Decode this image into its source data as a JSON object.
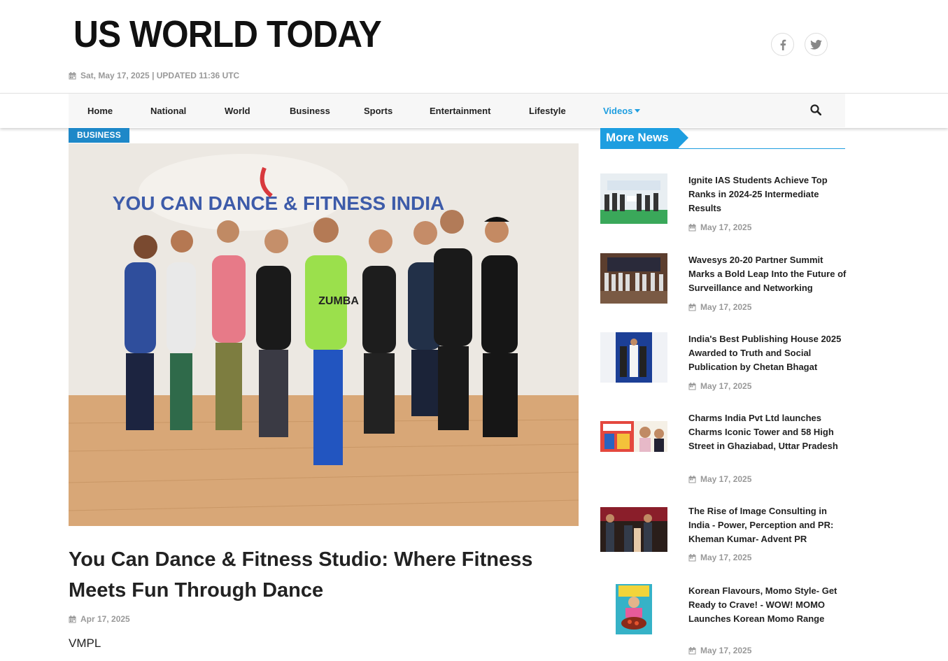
{
  "site": {
    "logo": "US WORLD TODAY",
    "date_line": "Sat, May 17, 2025 | UPDATED 11:36 UTC"
  },
  "social": [
    {
      "name": "facebook-icon"
    },
    {
      "name": "twitter-icon"
    }
  ],
  "nav": {
    "items": [
      "Home",
      "National",
      "World",
      "Business",
      "Sports",
      "Entertainment",
      "Lifestyle",
      "Videos"
    ],
    "active": "Videos"
  },
  "article": {
    "category": "BUSINESS",
    "title": "You Can Dance & Fitness Studio: Where Fitness Meets Fun Through Dance",
    "date": "Apr 17, 2025",
    "byline": "VMPL",
    "image_sign_text": "YOU CAN DANCE & FITNESS INDIA",
    "image_shirt_text": "ZUMBA"
  },
  "sidebar": {
    "heading": "More News",
    "items": [
      {
        "title": "Ignite IAS Students Achieve Top Ranks in 2024-25 Intermediate Results",
        "date": "May 17, 2025"
      },
      {
        "title": "Wavesys 20-20 Partner Summit Marks a Bold Leap Into the Future of Surveillance and Networking",
        "date": "May 17, 2025"
      },
      {
        "title": "India's Best Publishing House 2025 Awarded to Truth and Social Publication by Chetan Bhagat",
        "date": "May 17, 2025"
      },
      {
        "title": "Charms India Pvt Ltd launches Charms Iconic Tower and 58 High Street in Ghaziabad, Uttar Pradesh",
        "date": "May 17, 2025"
      },
      {
        "title": "The Rise of Image Consulting in India - Power, Perception and PR: Kheman Kumar- Advent PR",
        "date": "May 17, 2025"
      },
      {
        "title": "Korean Flavours, Momo Style- Get Ready to Crave! - WOW! MOMO Launches Korean Momo Range",
        "date": "May 17, 2025"
      }
    ]
  },
  "colors": {
    "accent": "#1e9ee0",
    "badge": "#1e88c8",
    "muted": "#999999"
  }
}
